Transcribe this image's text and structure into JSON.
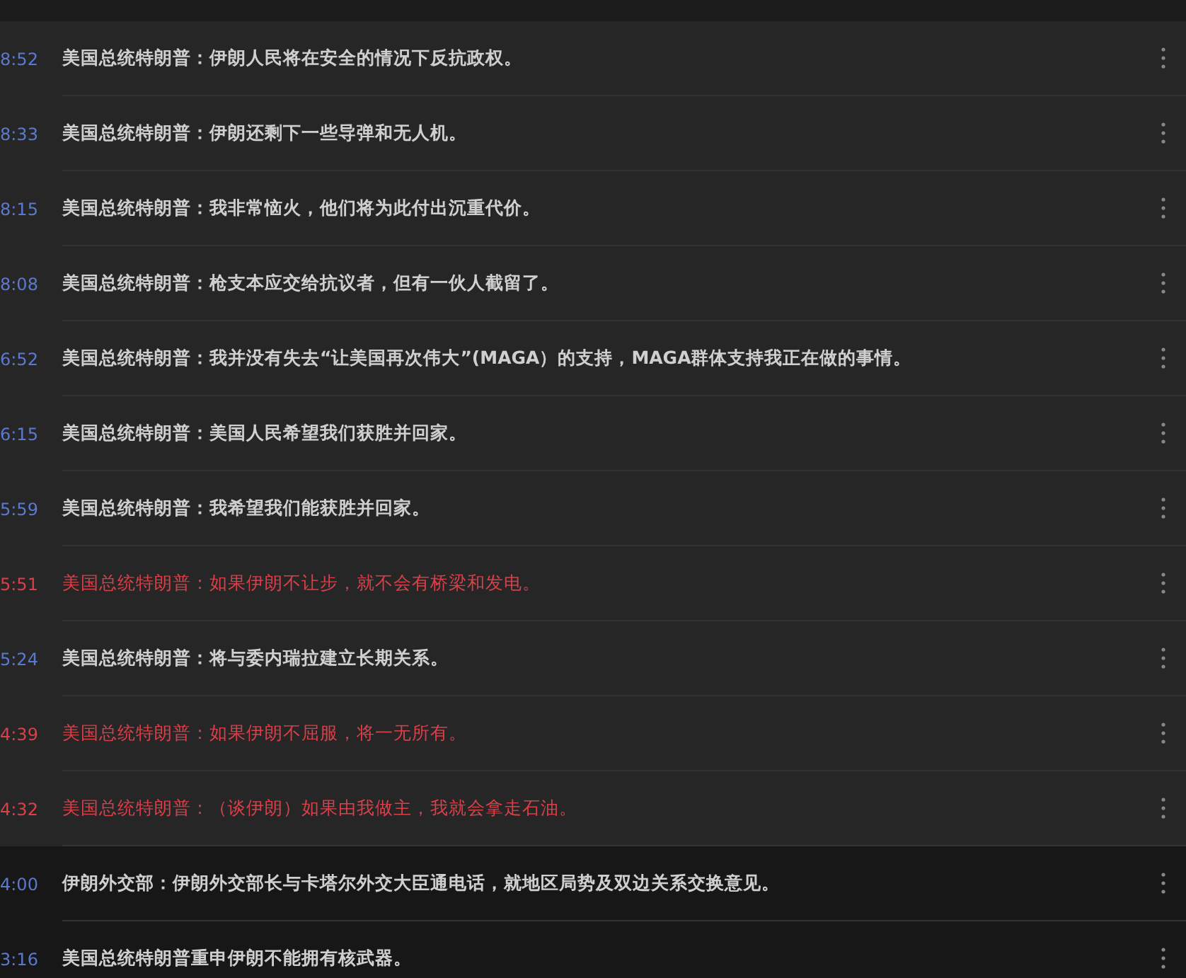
{
  "items": [
    {
      "time": "8:52",
      "text": "美国总统特朗普：伊朗人民将在安全的情况下反抗政权。",
      "important": false,
      "dimmed": false
    },
    {
      "time": "8:33",
      "text": "美国总统特朗普：伊朗还剩下一些导弹和无人机。",
      "important": false,
      "dimmed": false
    },
    {
      "time": "8:15",
      "text": "美国总统特朗普：我非常恼火，他们将为此付出沉重代价。",
      "important": false,
      "dimmed": false
    },
    {
      "time": "8:08",
      "text": "美国总统特朗普：枪支本应交给抗议者，但有一伙人截留了。",
      "important": false,
      "dimmed": false
    },
    {
      "time": "6:52",
      "text": "美国总统特朗普：我并没有失去“让美国再次伟大”(MAGA）的支持，MAGA群体支持我正在做的事情。",
      "important": false,
      "dimmed": false
    },
    {
      "time": "6:15",
      "text": "美国总统特朗普：美国人民希望我们获胜并回家。",
      "important": false,
      "dimmed": false
    },
    {
      "time": "5:59",
      "text": "美国总统特朗普：我希望我们能获胜并回家。",
      "important": false,
      "dimmed": false
    },
    {
      "time": "5:51",
      "text": "美国总统特朗普：如果伊朗不让步，就不会有桥梁和发电。",
      "important": true,
      "dimmed": false
    },
    {
      "time": "5:24",
      "text": "美国总统特朗普：将与委内瑞拉建立长期关系。",
      "important": false,
      "dimmed": false
    },
    {
      "time": "4:39",
      "text": "美国总统特朗普：如果伊朗不屈服，将一无所有。",
      "important": true,
      "dimmed": false
    },
    {
      "time": "4:32",
      "text": "美国总统特朗普：（谈伊朗）如果由我做主，我就会拿走石油。",
      "important": true,
      "dimmed": false
    },
    {
      "time": "4:00",
      "text": "伊朗外交部：伊朗外交部长与卡塔尔外交大臣通电话，就地区局势及双边关系交换意见。",
      "important": false,
      "dimmed": true
    },
    {
      "time": "3:16",
      "text": "美国总统特朗普重申伊朗不能拥有核武器。",
      "important": false,
      "dimmed": true
    }
  ]
}
